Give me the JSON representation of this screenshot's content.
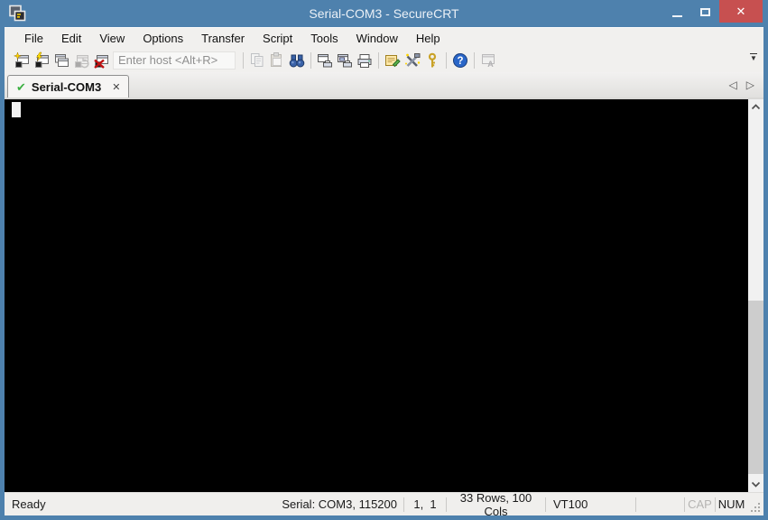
{
  "window": {
    "title": "Serial-COM3 - SecureCRT"
  },
  "menu": {
    "items": [
      "File",
      "Edit",
      "View",
      "Options",
      "Transfer",
      "Script",
      "Tools",
      "Window",
      "Help"
    ]
  },
  "toolbar": {
    "host_input": {
      "value": "",
      "placeholder": "Enter host <Alt+R>"
    }
  },
  "tab_bar": {
    "active_tab": {
      "label": "Serial-COM3"
    }
  },
  "terminal": {
    "content": ""
  },
  "status_bar": {
    "state": "Ready",
    "serial": "Serial: COM3, 115200",
    "cursor_position": "1,  1",
    "terminal_size": "33 Rows, 100 Cols",
    "emulation": "VT100",
    "caps_lock": "CAP",
    "num_lock": "NUM"
  },
  "icons": {
    "close_x": "✕",
    "tab_check": "✔",
    "tab_close": "✕",
    "prev_tab": "◁",
    "next_tab": "▷",
    "toolbar_overflow": "▼"
  },
  "colors": {
    "titlebar": "#4e81ad",
    "close_button": "#c75050",
    "chrome_bg": "#f1f0ee",
    "terminal_bg": "#000000",
    "check_green": "#3cb043",
    "scroll_thumb": "#cdcdcd"
  }
}
